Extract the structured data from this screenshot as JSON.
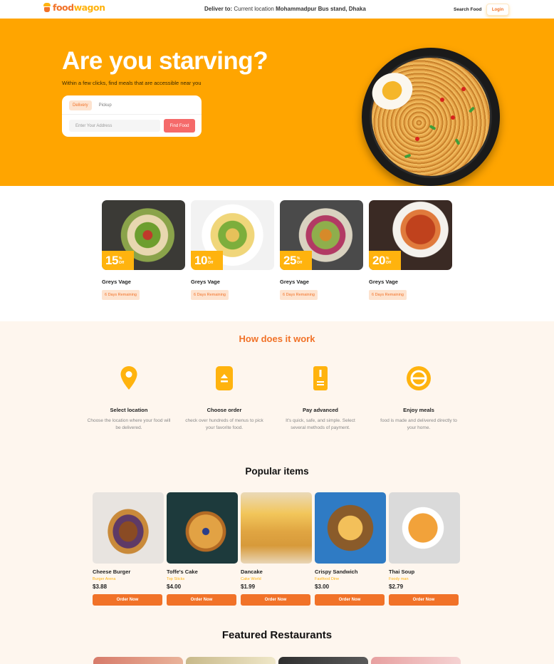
{
  "nav": {
    "logo_part1": "food",
    "logo_part2": "wagon",
    "deliver_label": "Deliver to:",
    "deliver_current": "Current location",
    "deliver_address": "Mohammadpur Bus stand, Dhaka",
    "search_label": "Search Food",
    "login_label": "Login"
  },
  "hero": {
    "title": "Are you starving?",
    "subtitle": "Within a few clicks, find meals that are accessible near you",
    "tabs": [
      "Delivery",
      "Pickup"
    ],
    "address_placeholder": "Enter Your Address",
    "find_button": "Find Food"
  },
  "deals": [
    {
      "discount": "15",
      "unit": "%",
      "off": "Off",
      "name": "Greys Vage",
      "remaining": "6 Days Remaining"
    },
    {
      "discount": "10",
      "unit": "%",
      "off": "Off",
      "name": "Greys Vage",
      "remaining": "6 Days Remaining"
    },
    {
      "discount": "25",
      "unit": "%",
      "off": "Off",
      "name": "Greys Vage",
      "remaining": "6 Days Remaining"
    },
    {
      "discount": "20",
      "unit": "%",
      "off": "Off",
      "name": "Greys Vage",
      "remaining": "6 Days Remaining"
    }
  ],
  "how": {
    "title": "How does it work",
    "steps": [
      {
        "title": "Select location",
        "desc": "Choose the location where your food will be delivered.",
        "icon": "location-pin-icon"
      },
      {
        "title": "Choose order",
        "desc": "check over hundreds of menus to pick your favorite food.",
        "icon": "order-icon"
      },
      {
        "title": "Pay advanced",
        "desc": "It's quick, safe, and simple. Select several methods of payment.",
        "icon": "payment-icon"
      },
      {
        "title": "Enjoy meals",
        "desc": "food is made and delivered directly to your home.",
        "icon": "meal-icon"
      }
    ]
  },
  "popular": {
    "title": "Popular items",
    "items": [
      {
        "name": "Cheese Burger",
        "shop": "Burger Arena",
        "price": "$3.88",
        "button": "Order Now"
      },
      {
        "name": "Toffe's Cake",
        "shop": "Top Sticks",
        "price": "$4.00",
        "button": "Order Now"
      },
      {
        "name": "Dancake",
        "shop": "Cake World",
        "price": "$1.99",
        "button": "Order Now"
      },
      {
        "name": "Crispy Sandwich",
        "shop": "Fastfood Dine",
        "price": "$3.00",
        "button": "Order Now"
      },
      {
        "name": "Thai Soup",
        "shop": "Foody man",
        "price": "$2.79",
        "button": "Order Now"
      }
    ]
  },
  "featured": {
    "title": "Featured Restaurants"
  },
  "colors": {
    "brand_orange": "#f17228",
    "brand_yellow": "#ffb30e",
    "hero_bg": "#ffa500",
    "section_bg": "#fef6ee"
  }
}
